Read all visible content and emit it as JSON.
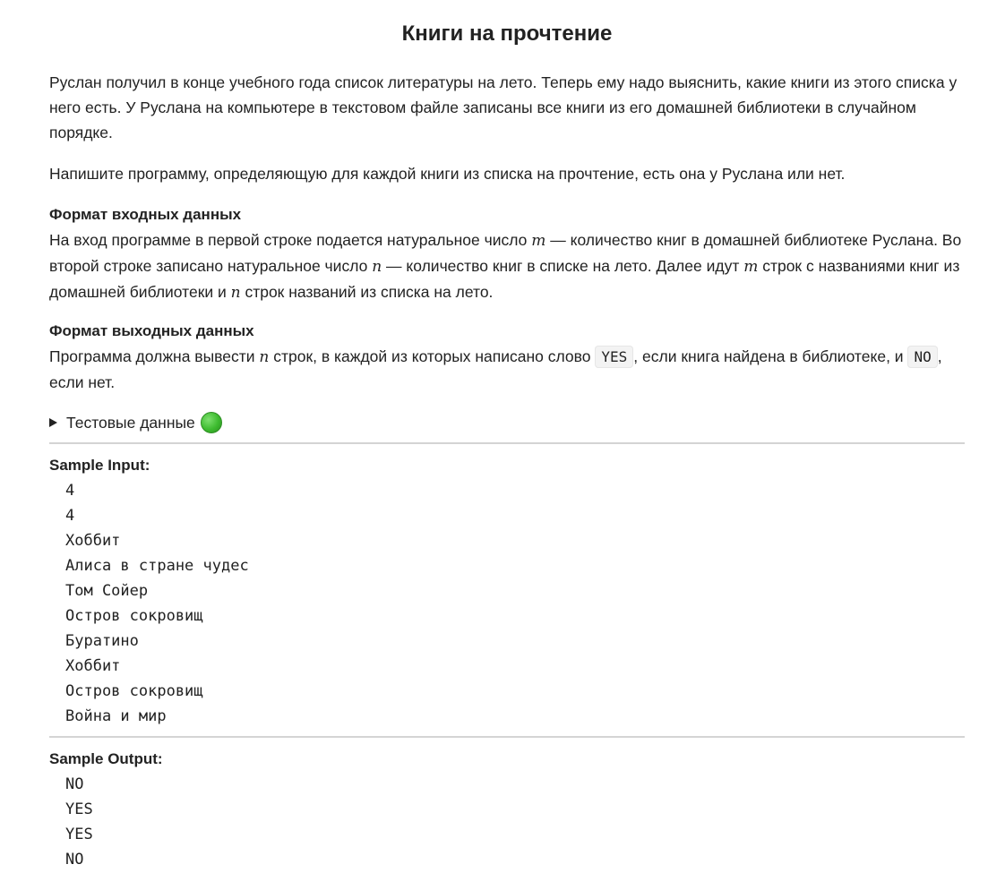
{
  "title": "Книги на прочтение",
  "para1": "Руслан получил в конце учебного года список литературы на лето. Теперь ему надо выяснить, какие книги из этого списка у него есть. У Руслана на компьютере в текстовом файле записаны все книги из его домашней библиотеки в случайном порядке.",
  "para2": "Напишите программу, определяющую для каждой книги из списка на прочтение, есть она у Руслана или нет.",
  "input_format": {
    "title": "Формат входных данных",
    "t1": "На вход программе в первой строке подается натуральное число ",
    "v1": "m",
    "t2": " — количество книг в домашней библиотеке Руслана. Во второй строке записано натуральное число ",
    "v2": "n",
    "t3": " —  количество книг в списке на лето. Далее идут ",
    "v3": "m",
    "t4": " строк с названиями книг из домашней библиотеки и ",
    "v4": "n",
    "t5": " строк названий из списка на лето."
  },
  "output_format": {
    "title": "Формат выходных данных",
    "t1": "Программа должна вывести ",
    "v1": "n",
    "t2": " строк, в каждой из которых написано слово ",
    "code1": "YES",
    "t3": ", если книга найдена в библиотеке, и ",
    "code2": "NO",
    "t4": ", если нет."
  },
  "details": {
    "label": "Тестовые данные",
    "status_icon": "green-circle",
    "status_color": "#3dbb2f"
  },
  "sample_input": {
    "title": "Sample Input:",
    "lines": [
      "4",
      "4",
      "Хоббит",
      "Алиса в стране чудес",
      "Том Сойер",
      "Остров сокровищ",
      "Буратино",
      "Хоббит",
      "Остров сокровищ",
      "Война и мир"
    ]
  },
  "sample_output": {
    "title": "Sample Output:",
    "lines": [
      "NO",
      "YES",
      "YES",
      "NO"
    ]
  }
}
